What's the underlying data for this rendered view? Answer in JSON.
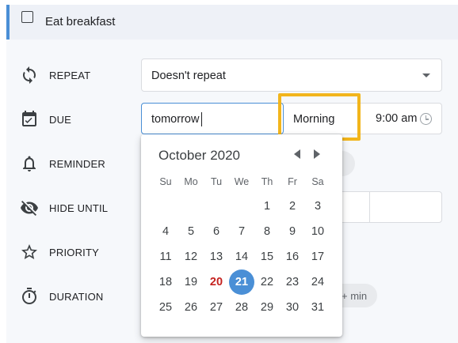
{
  "task": {
    "title": "Eat breakfast"
  },
  "rows": {
    "repeat": {
      "label": "REPEAT",
      "icon": "repeat-icon",
      "value": "Doesn't repeat"
    },
    "due": {
      "label": "DUE",
      "icon": "calendar-icon",
      "date_value": "tomorrow",
      "time_of_day": "Morning",
      "time": "9:00 am"
    },
    "reminder": {
      "label": "REMINDER",
      "icon": "bell-icon"
    },
    "hide_until": {
      "label": "HIDE UNTIL",
      "icon": "eye-off-icon"
    },
    "priority": {
      "label": "PRIORITY",
      "icon": "star-icon"
    },
    "duration": {
      "label": "DURATION",
      "icon": "timer-icon",
      "chip": "+ min"
    }
  },
  "calendar": {
    "month_label": "October 2020",
    "weekdays": [
      "Su",
      "Mo",
      "Tu",
      "We",
      "Th",
      "Fr",
      "Sa"
    ],
    "weeks": [
      [
        "",
        "",
        "",
        "",
        "1",
        "2",
        "3"
      ],
      [
        "4",
        "5",
        "6",
        "7",
        "8",
        "9",
        "10"
      ],
      [
        "11",
        "12",
        "13",
        "14",
        "15",
        "16",
        "17"
      ],
      [
        "18",
        "19",
        "20",
        "21",
        "22",
        "23",
        "24"
      ],
      [
        "25",
        "26",
        "27",
        "28",
        "29",
        "30",
        "31"
      ]
    ],
    "today": "20",
    "selected": "21"
  },
  "colors": {
    "accent": "#4a8fd6",
    "today": "#c5221f",
    "highlight": "#f2b51c"
  }
}
